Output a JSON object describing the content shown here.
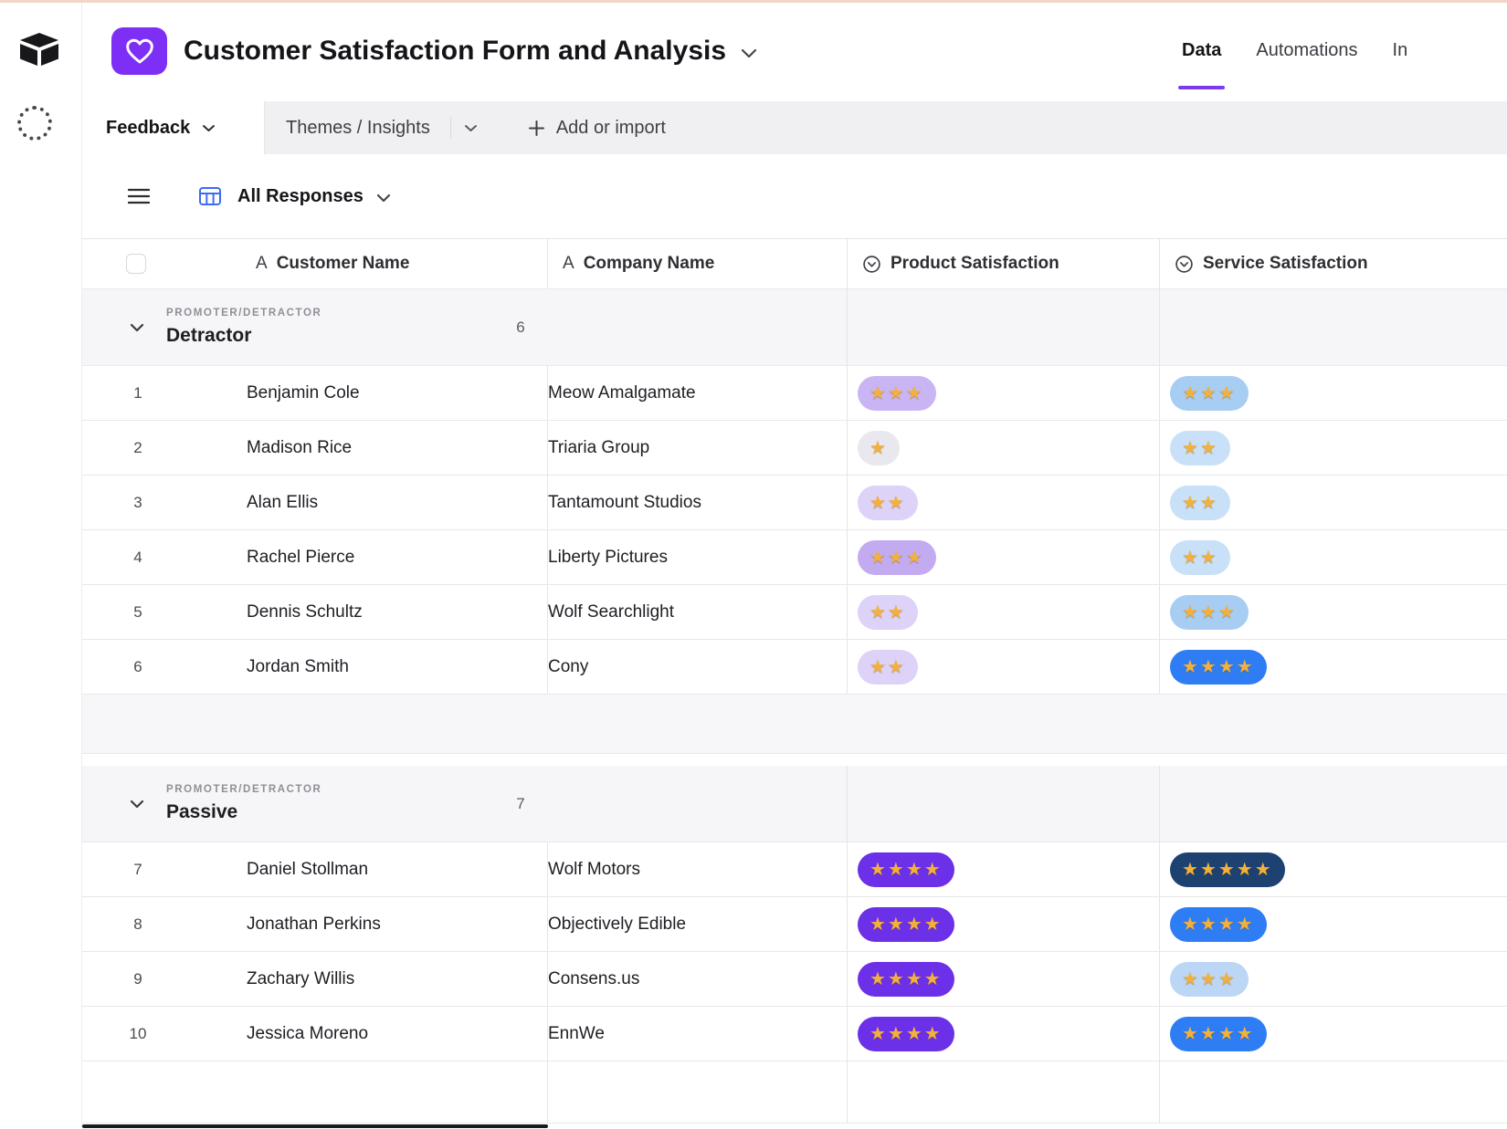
{
  "brand": {
    "accent": "#7c3aed",
    "app_icon_bg": "#7e2ff5",
    "top_strip": "#f2d4c9"
  },
  "icons": {
    "star": "★",
    "text_field_letter": "A"
  },
  "header": {
    "title": "Customer Satisfaction Form and Analysis",
    "nav": [
      {
        "label": "Data",
        "active": true
      },
      {
        "label": "Automations",
        "active": false
      },
      {
        "label": "Interfaces",
        "active": false,
        "clipped": true
      }
    ]
  },
  "tab_bar": {
    "tabs": [
      {
        "label": "Feedback",
        "active": true
      },
      {
        "label": "Themes / Insights",
        "active": false
      }
    ],
    "add_label": "Add or import"
  },
  "view_bar": {
    "view_name": "All Responses"
  },
  "table": {
    "columns": [
      {
        "label": "Customer Name",
        "icon": "text-field-icon"
      },
      {
        "label": "Company Name",
        "icon": "text-field-icon"
      },
      {
        "label": "Product Satisfaction",
        "icon": "select-field-icon"
      },
      {
        "label": "Service Satisfaction",
        "icon": "select-field-icon"
      }
    ],
    "group_field_label": "PROMOTER/DETRACTOR",
    "groups": [
      {
        "name": "Detractor",
        "count": "6",
        "rows": [
          {
            "num": "1",
            "customer": "Benjamin Cole",
            "company": "Meow Amalgamate",
            "product_stars": 3,
            "product_bg": "#c9b5f3",
            "service_stars": 3,
            "service_bg": "#a8cdf2"
          },
          {
            "num": "2",
            "customer": "Madison Rice",
            "company": "Triaria Group",
            "product_stars": 1,
            "product_bg": "#e9e8ee",
            "service_stars": 2,
            "service_bg": "#c8e0f8"
          },
          {
            "num": "3",
            "customer": "Alan Ellis",
            "company": "Tantamount Studios",
            "product_stars": 2,
            "product_bg": "#ddd2f7",
            "service_stars": 2,
            "service_bg": "#c8e0f8"
          },
          {
            "num": "4",
            "customer": "Rachel Pierce",
            "company": "Liberty Pictures",
            "product_stars": 3,
            "product_bg": "#c2abf1",
            "service_stars": 2,
            "service_bg": "#c8e0f8"
          },
          {
            "num": "5",
            "customer": "Dennis Schultz",
            "company": "Wolf Searchlight",
            "product_stars": 2,
            "product_bg": "#ddd2f7",
            "service_stars": 3,
            "service_bg": "#a8cdf2"
          },
          {
            "num": "6",
            "customer": "Jordan Smith",
            "company": "Cony",
            "product_stars": 2,
            "product_bg": "#ddd2f7",
            "service_stars": 4,
            "service_bg": "#2f7df5"
          }
        ]
      },
      {
        "name": "Passive",
        "count": "7",
        "rows": [
          {
            "num": "7",
            "customer": "Daniel Stollman",
            "company": "Wolf Motors",
            "product_stars": 4,
            "product_bg": "#6c30e8",
            "service_stars": 5,
            "service_bg": "#1d4170"
          },
          {
            "num": "8",
            "customer": "Jonathan Perkins",
            "company": "Objectively Edible",
            "product_stars": 4,
            "product_bg": "#6c30e8",
            "service_stars": 4,
            "service_bg": "#2f7df5"
          },
          {
            "num": "9",
            "customer": "Zachary Willis",
            "company": "Consens.us",
            "product_stars": 4,
            "product_bg": "#6c30e8",
            "service_stars": 3,
            "service_bg": "#bcd6f6"
          },
          {
            "num": "10",
            "customer": "Jessica Moreno",
            "company": "EnnWe",
            "product_stars": 4,
            "product_bg": "#6c30e8",
            "service_stars": 4,
            "service_bg": "#2f7df5"
          }
        ]
      }
    ]
  }
}
